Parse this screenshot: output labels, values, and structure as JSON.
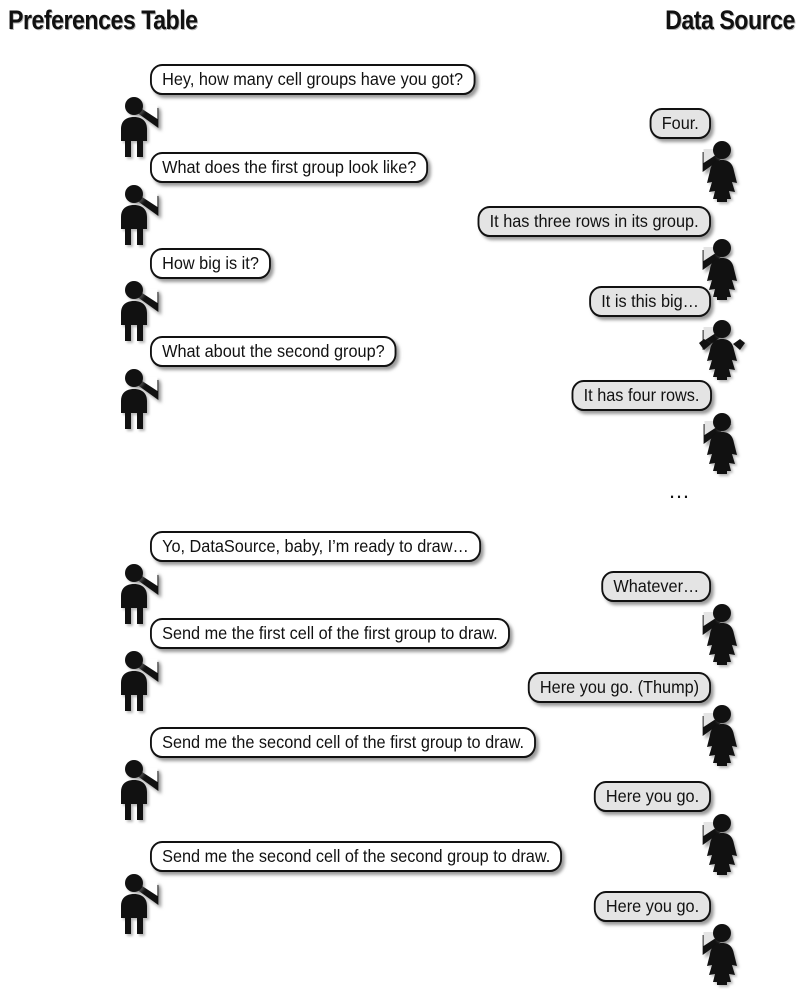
{
  "headers": {
    "left": "Preferences Table",
    "right": "Data Source"
  },
  "ellipsis": "…",
  "icons": {
    "male_actor": "male-figure-icon",
    "female_actor": "female-figure-icon",
    "female_actor_arms_up": "female-figure-arms-raised-icon"
  },
  "colors": {
    "ink": "#111111",
    "bubble_left_fill": "#ffffff",
    "bubble_right_fill": "#e4e4e4",
    "background": "#ffffff",
    "shadow": "#6e6e6e"
  },
  "conversation": {
    "first_exchange": [
      {
        "speaker": "Preferences Table",
        "side": "left",
        "text": "Hey, how many cell groups have you got?",
        "actor": "male-figure-icon"
      },
      {
        "speaker": "Data Source",
        "side": "right",
        "text": "Four.",
        "actor": "female-figure-icon"
      },
      {
        "speaker": "Preferences Table",
        "side": "left",
        "text": "What does the first group look like?",
        "actor": "male-figure-icon"
      },
      {
        "speaker": "Data Source",
        "side": "right",
        "text": "It has three rows in its group.",
        "actor": "female-figure-icon"
      },
      {
        "speaker": "Preferences Table",
        "side": "left",
        "text": "How big is it?",
        "actor": "male-figure-icon"
      },
      {
        "speaker": "Data Source",
        "side": "right",
        "text": "It is this big…",
        "actor": "female-figure-arms-raised-icon"
      },
      {
        "speaker": "Preferences Table",
        "side": "left",
        "text": "What about the second group?",
        "actor": "male-figure-icon"
      },
      {
        "speaker": "Data Source",
        "side": "right",
        "text": "It has four rows.",
        "actor": "female-figure-icon"
      }
    ],
    "second_exchange": [
      {
        "speaker": "Preferences Table",
        "side": "left",
        "text": "Yo, DataSource, baby, I’m ready to draw…",
        "actor": "male-figure-icon"
      },
      {
        "speaker": "Data Source",
        "side": "right",
        "text": "Whatever…",
        "actor": "female-figure-icon"
      },
      {
        "speaker": "Preferences Table",
        "side": "left",
        "text": "Send me the first cell of the first group to draw.",
        "actor": "male-figure-icon"
      },
      {
        "speaker": "Data Source",
        "side": "right",
        "text": "Here you go. (Thump)",
        "actor": "female-figure-icon"
      },
      {
        "speaker": "Preferences Table",
        "side": "left",
        "text": "Send me the second cell of the first group to draw.",
        "actor": "male-figure-icon"
      },
      {
        "speaker": "Data Source",
        "side": "right",
        "text": "Here you go.",
        "actor": "female-figure-icon"
      },
      {
        "speaker": "Preferences Table",
        "side": "left",
        "text": "Send me the second cell of the second group to draw.",
        "actor": "male-figure-icon"
      },
      {
        "speaker": "Data Source",
        "side": "right",
        "text": "Here you go.",
        "actor": "female-figure-icon"
      }
    ]
  }
}
